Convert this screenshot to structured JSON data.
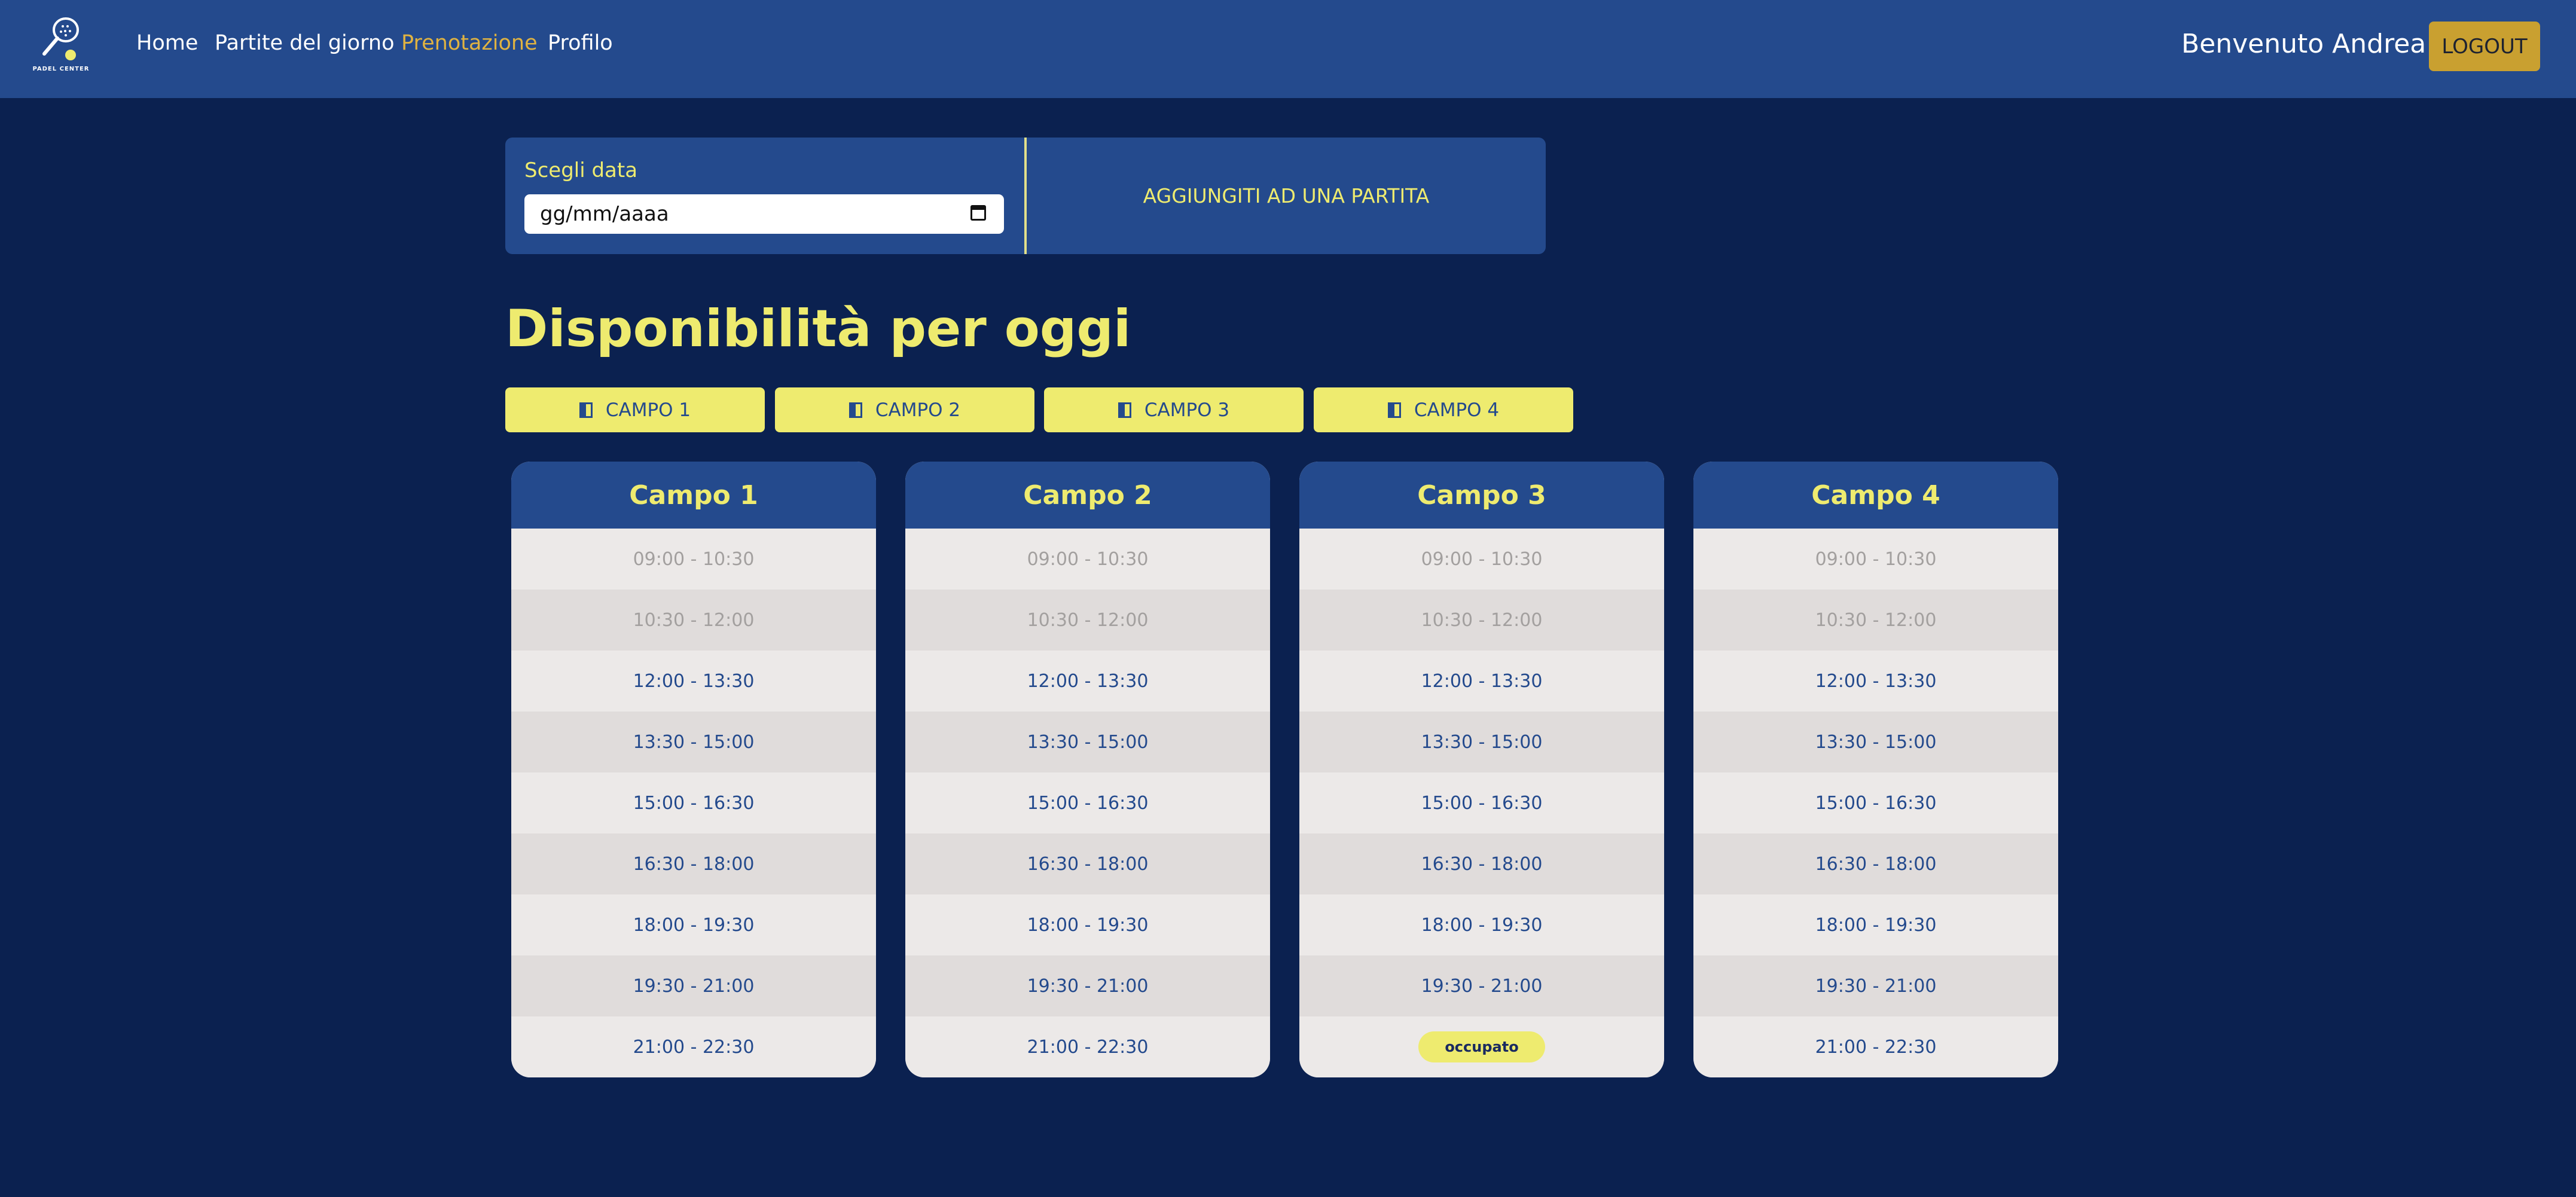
{
  "navbar": {
    "logo_text": "PADEL CENTER",
    "links": [
      "Home",
      "Partite del giorno",
      "Prenotazione",
      "Profilo"
    ],
    "welcome": "Benvenuto Andrea",
    "logout": "LOGOUT"
  },
  "booking": {
    "date_label": "Scegli data",
    "date_placeholder": "gg/mm/aaaa",
    "join_label": "AGGIUNGITI AD UNA PARTITA"
  },
  "heading": "Disponibilità per oggi",
  "filters": [
    "CAMPO 1",
    "CAMPO 2",
    "CAMPO 3",
    "CAMPO 4"
  ],
  "courts": [
    {
      "title": "Campo 1",
      "slots": [
        "09:00 - 10:30",
        "10:30 - 12:00",
        "12:00 - 13:30",
        "13:30 - 15:00",
        "15:00 - 16:30",
        "16:30 - 18:00",
        "18:00 - 19:30",
        "19:30 - 21:00",
        "21:00 - 22:30"
      ]
    },
    {
      "title": "Campo 2",
      "slots": [
        "09:00 - 10:30",
        "10:30 - 12:00",
        "12:00 - 13:30",
        "13:30 - 15:00",
        "15:00 - 16:30",
        "16:30 - 18:00",
        "18:00 - 19:30",
        "19:30 - 21:00",
        "21:00 - 22:30"
      ]
    },
    {
      "title": "Campo 3",
      "slots": [
        "09:00 - 10:30",
        "10:30 - 12:00",
        "12:00 - 13:30",
        "13:30 - 15:00",
        "15:00 - 16:30",
        "16:30 - 18:00",
        "18:00 - 19:30",
        "19:30 - 21:00",
        "occupato"
      ]
    },
    {
      "title": "Campo 4",
      "slots": [
        "09:00 - 10:30",
        "10:30 - 12:00",
        "12:00 - 13:30",
        "13:30 - 15:00",
        "15:00 - 16:30",
        "16:30 - 18:00",
        "18:00 - 19:30",
        "19:30 - 21:00",
        "21:00 - 22:30"
      ]
    }
  ],
  "colors": {
    "background": "#0b2150",
    "navbar": "#244a8d",
    "accent_yellow": "#eeeb6f",
    "active_link": "#e0b341",
    "logout": "#c9a030"
  }
}
